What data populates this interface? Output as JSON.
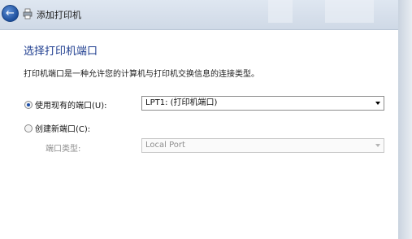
{
  "window": {
    "title": "添加打印机"
  },
  "page": {
    "heading": "选择打印机端口",
    "description": "打印机端口是一种允许您的计算机与打印机交换信息的连接类型。"
  },
  "options": {
    "use_existing": {
      "label": "使用现有的端口(U):",
      "checked": true,
      "selected_value": "LPT1: (打印机端口)"
    },
    "create_new": {
      "label": "创建新端口(C):",
      "checked": false
    },
    "port_type": {
      "label": "端口类型:",
      "selected_value": "Local Port",
      "enabled": false
    }
  },
  "icons": {
    "back": "back-arrow-icon",
    "printer": "printer-icon"
  },
  "colors": {
    "heading": "#1e3d8f",
    "accent": "#1d4fa8"
  }
}
